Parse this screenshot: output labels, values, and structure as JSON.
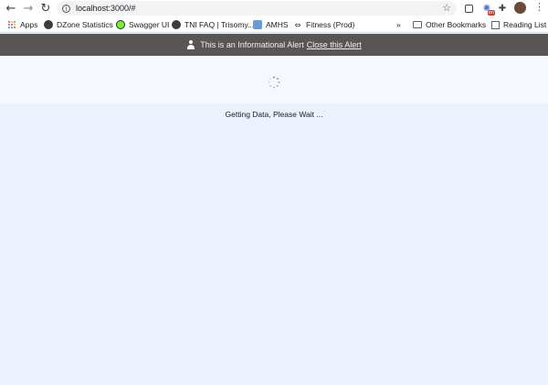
{
  "browser": {
    "url": "localhost:3000/#",
    "nav": {
      "back_icon": "arrow-left-icon",
      "forward_icon": "arrow-right-icon",
      "reload_icon": "reload-icon"
    },
    "bookmarks": [
      {
        "label": "Apps",
        "icon": "apps-grid-icon"
      },
      {
        "label": "DZone Statistics",
        "icon": "globe-icon"
      },
      {
        "label": "Swagger UI",
        "icon": "swagger-icon"
      },
      {
        "label": "TNI FAQ | Trisomy...",
        "icon": "globe-icon"
      },
      {
        "label": "AMHS",
        "icon": "amhs-icon"
      },
      {
        "label": "Fitness (Prod)",
        "icon": "arrows-icon"
      }
    ],
    "overflow": "»",
    "other_bookmarks": "Other Bookmarks",
    "reading_list": "Reading List"
  },
  "alert": {
    "message": "This is an Informational Alert",
    "close_link": "Close this Alert",
    "icon": "user-icon"
  },
  "loading": {
    "status_text": "Getting Data, Please Wait ...",
    "icon": "spinner-icon"
  },
  "colors": {
    "alert_bg": "#595555",
    "page_bg": "#ebf1fd",
    "panel_bg": "#f6f8fe"
  }
}
